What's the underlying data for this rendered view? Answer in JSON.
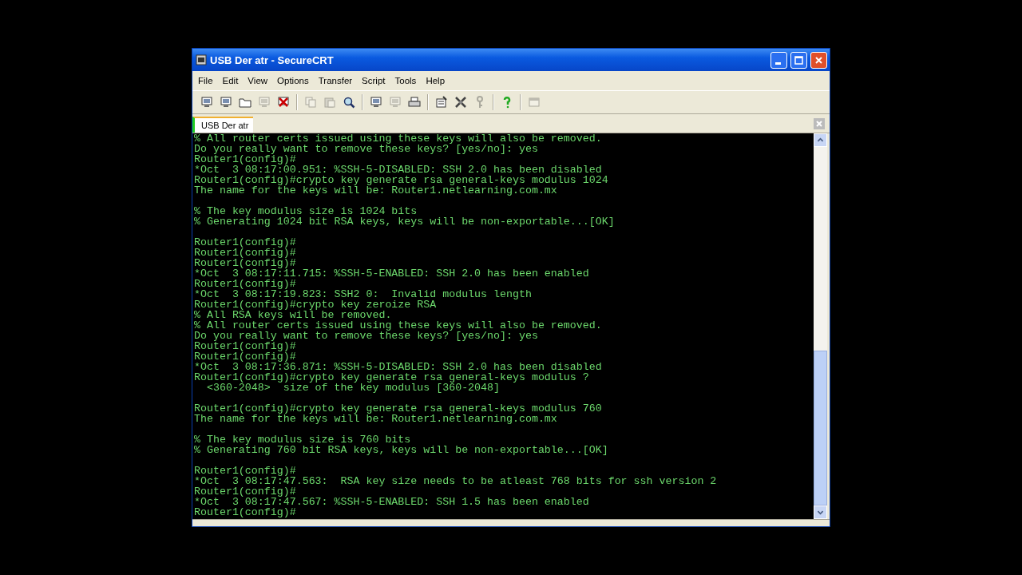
{
  "window": {
    "title": "USB Der atr - SecureCRT"
  },
  "menu": [
    "File",
    "Edit",
    "View",
    "Options",
    "Transfer",
    "Script",
    "Tools",
    "Help"
  ],
  "toolbar": [
    [
      {
        "kind": "monitor",
        "disabled": false
      },
      {
        "kind": "monitor",
        "disabled": false
      },
      {
        "kind": "folder",
        "disabled": false
      },
      {
        "kind": "monitor",
        "disabled": true
      },
      {
        "kind": "disconnect",
        "disabled": false
      }
    ],
    [
      {
        "kind": "copy",
        "disabled": true
      },
      {
        "kind": "paste",
        "disabled": true
      },
      {
        "kind": "search",
        "disabled": false
      }
    ],
    [
      {
        "kind": "monitor",
        "disabled": false
      },
      {
        "kind": "monitor",
        "disabled": true
      },
      {
        "kind": "print",
        "disabled": false
      }
    ],
    [
      {
        "kind": "properties",
        "disabled": false
      },
      {
        "kind": "tools",
        "disabled": false
      },
      {
        "kind": "key",
        "disabled": true
      }
    ],
    [
      {
        "kind": "help",
        "disabled": false
      }
    ],
    [
      {
        "kind": "window",
        "disabled": true
      }
    ]
  ],
  "tabs": [
    {
      "label": "USB Der atr",
      "selected": true
    }
  ],
  "terminal": {
    "blocks": [
      [
        "% All router certs issued using these keys will also be removed.",
        "Do you really want to remove these keys? [yes/no]: yes",
        "Router1(config)#",
        "*Oct  3 08:17:00.951: %SSH-5-DISABLED: SSH 2.0 has been disabled",
        "Router1(config)#crypto key generate rsa general-keys modulus 1024",
        "The name for the keys will be: Router1.netlearning.com.mx"
      ],
      [
        "% The key modulus size is 1024 bits",
        "% Generating 1024 bit RSA keys, keys will be non-exportable...[OK]"
      ],
      [
        "Router1(config)#",
        "Router1(config)#",
        "Router1(config)#",
        "*Oct  3 08:17:11.715: %SSH-5-ENABLED: SSH 2.0 has been enabled",
        "Router1(config)#",
        "*Oct  3 08:17:19.823: SSH2 0:  Invalid modulus length",
        "Router1(config)#crypto key zeroize RSA",
        "% All RSA keys will be removed.",
        "% All router certs issued using these keys will also be removed.",
        "Do you really want to remove these keys? [yes/no]: yes",
        "Router1(config)#",
        "Router1(config)#",
        "*Oct  3 08:17:36.871: %SSH-5-DISABLED: SSH 2.0 has been disabled",
        "Router1(config)#crypto key generate rsa general-keys modulus ?",
        "  <360-2048>  size of the key modulus [360-2048]"
      ],
      [
        "Router1(config)#crypto key generate rsa general-keys modulus 760",
        "The name for the keys will be: Router1.netlearning.com.mx"
      ],
      [
        "% The key modulus size is 760 bits",
        "% Generating 760 bit RSA keys, keys will be non-exportable...[OK]"
      ],
      [
        "Router1(config)#",
        "*Oct  3 08:17:47.563:  RSA key size needs to be atleast 768 bits for ssh version 2",
        "Router1(config)#",
        "*Oct  3 08:17:47.567: %SSH-5-ENABLED: SSH 1.5 has been enabled",
        "Router1(config)#"
      ]
    ]
  }
}
